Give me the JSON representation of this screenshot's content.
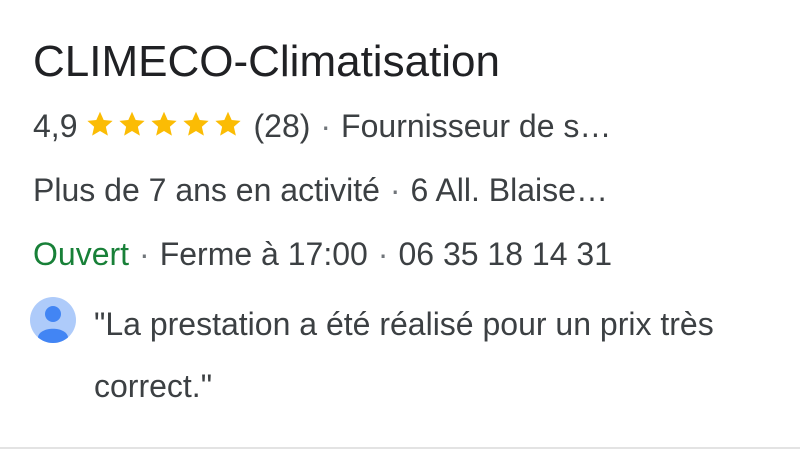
{
  "business": {
    "name": "CLIMECO-Climatisation",
    "rating": "4,9",
    "stars": 5,
    "review_count": "(28)",
    "category": "Fournisseur de s…",
    "years_active": "Plus de 7 ans en activité",
    "address": "6 All. Blaise…",
    "status": "Ouvert",
    "hours": "Ferme à 17:00",
    "phone": "06 35 18 14 31"
  },
  "separator": "·",
  "review": {
    "avatar_icon": "person-icon",
    "text": "\"La prestation a été réalisé pour un prix très correct.\""
  },
  "colors": {
    "star": "#fbbc04",
    "open": "#188038",
    "text": "#3c4043",
    "title": "#202124",
    "avatar_bg": "#aecbfa",
    "avatar_fg": "#4285f4"
  }
}
